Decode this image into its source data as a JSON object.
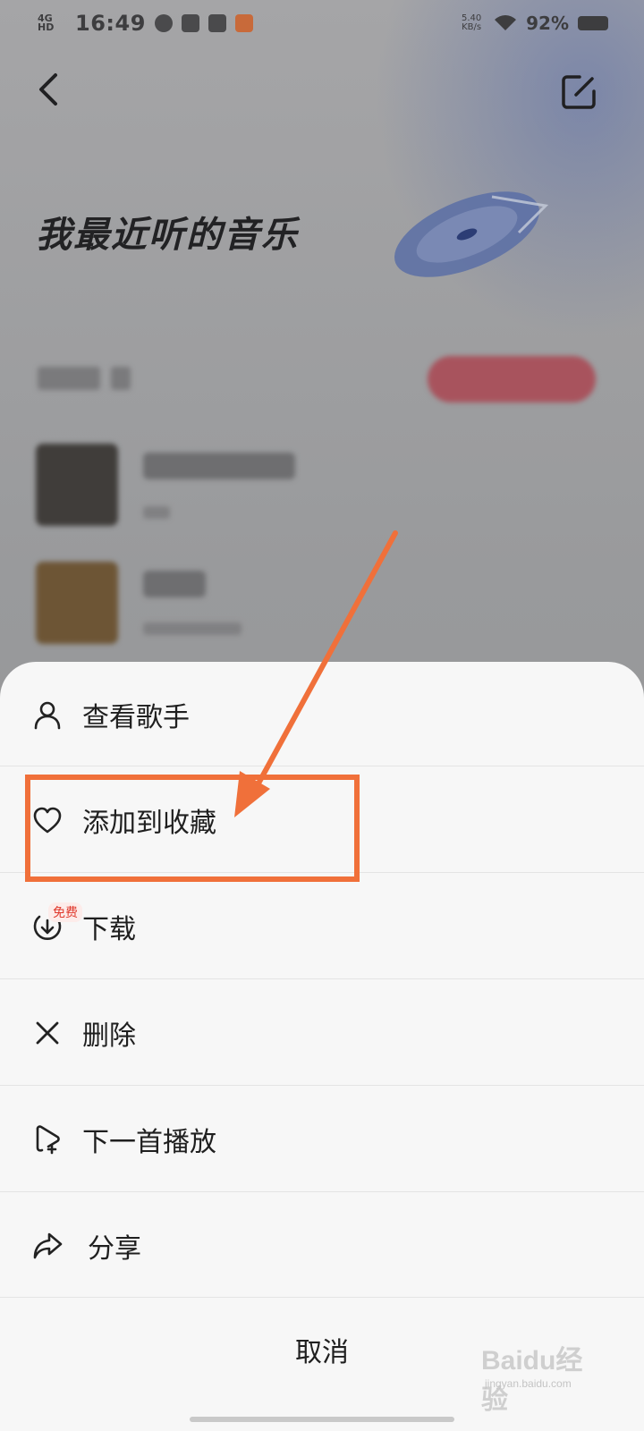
{
  "statusbar": {
    "network": "4G HD",
    "time": "16:49",
    "speed": "5.40 KB/s",
    "battery": "92%"
  },
  "header": {
    "back_icon": "chevron-left-icon",
    "edit_icon": "edit-icon"
  },
  "playlist": {
    "title": "我最近听的音乐"
  },
  "menu": {
    "items": [
      {
        "label": "查看歌手",
        "icon": "person-icon"
      },
      {
        "label": "添加到收藏",
        "icon": "heart-icon"
      },
      {
        "label": "下载",
        "icon": "download-icon",
        "badge": "免费"
      },
      {
        "label": "删除",
        "icon": "close-icon"
      },
      {
        "label": "下一首播放",
        "icon": "play-next-icon"
      },
      {
        "label": "分享",
        "icon": "share-icon"
      }
    ],
    "cancel_label": "取消"
  },
  "annotation": {
    "color": "#f0703a"
  },
  "watermark": {
    "text": "Baidu经验",
    "sub": "jingyan.baidu.com"
  }
}
